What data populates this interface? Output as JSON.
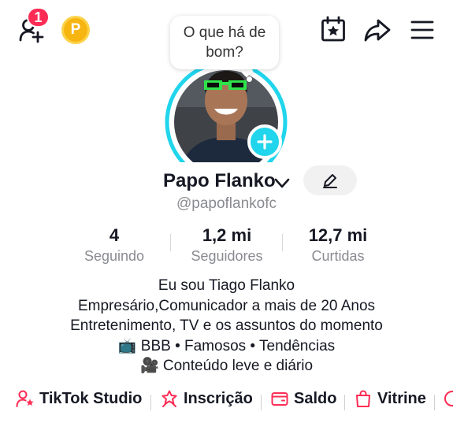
{
  "header": {
    "notification_count": "1",
    "coin_letter": "P",
    "icons": [
      "add-friend-icon",
      "coin-icon",
      "calendar-star-icon",
      "share-icon",
      "menu-icon"
    ]
  },
  "status_bubble": {
    "text": "O que há de bom?"
  },
  "profile": {
    "name": "Papo Flanko",
    "handle": "@papoflankofc"
  },
  "stats": [
    {
      "value": "4",
      "label": "Seguindo"
    },
    {
      "value": "1,2 mi",
      "label": "Seguidores"
    },
    {
      "value": "12,7 mi",
      "label": "Curtidas"
    }
  ],
  "bio": [
    "Eu sou Tiago Flanko",
    "Empresário,Comunicador a mais de 20 Anos",
    "Entretenimento, TV e os assuntos do momento",
    "📺 BBB • Famosos • Tendências",
    "🎥 Conteúdo leve e diário"
  ],
  "shortcuts": [
    {
      "label": "TikTok Studio",
      "icon": "person-star-icon"
    },
    {
      "label": "Inscrição",
      "icon": "star-ribbon-icon"
    },
    {
      "label": "Saldo",
      "icon": "wallet-icon"
    },
    {
      "label": "Vitrine",
      "icon": "shopping-bag-icon"
    }
  ],
  "colors": {
    "accent_red": "#fe2c55",
    "ring_cyan": "#20d5ec",
    "coin_gold": "#f7b512",
    "text_primary": "#161823",
    "text_secondary": "#8a8b91"
  }
}
